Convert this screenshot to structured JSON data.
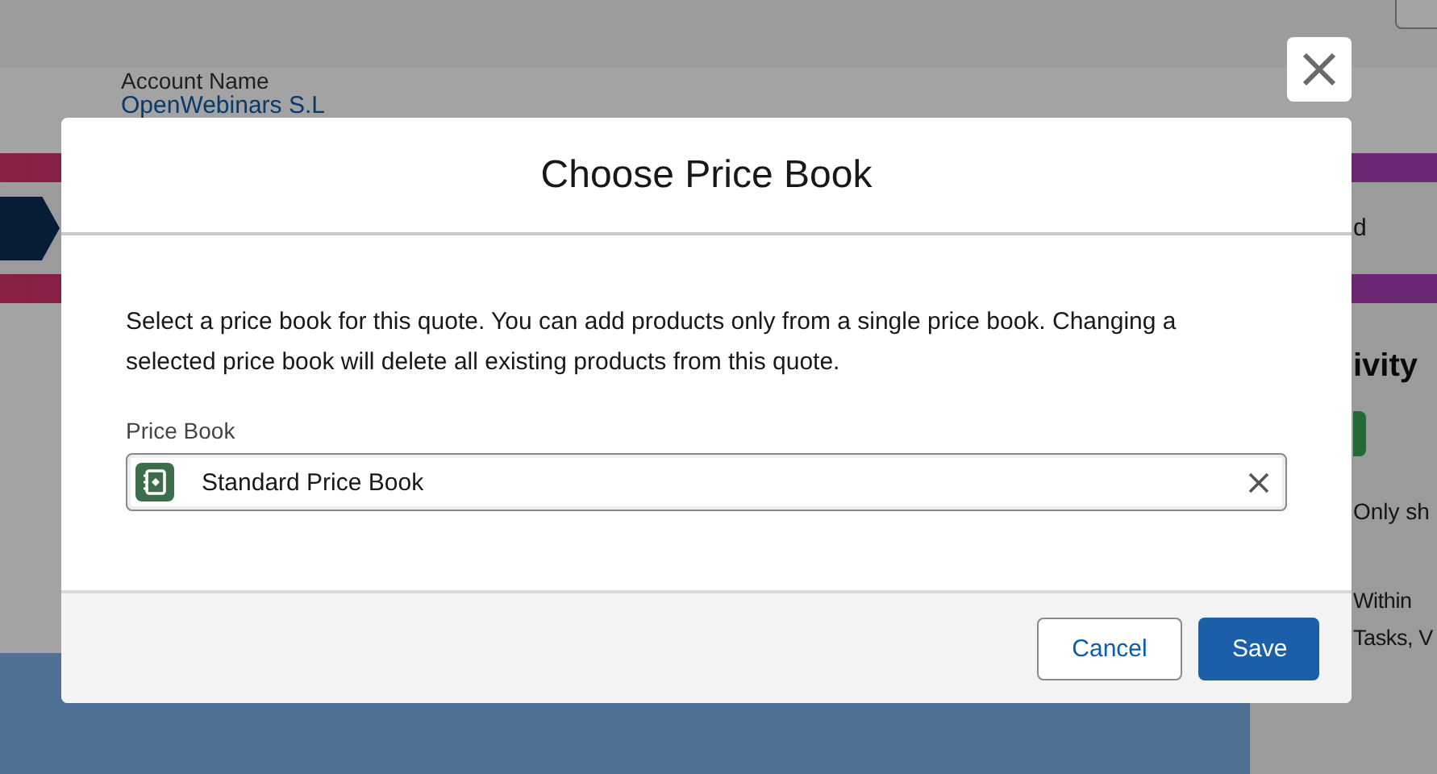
{
  "background": {
    "account_label": "Account Name",
    "account_name": "OpenWebinars S.L",
    "path_stage": "d",
    "activity_tab": "ivity",
    "filter_text": "Only sh",
    "info_lines": [
      "Within",
      "Tasks, V"
    ]
  },
  "modal": {
    "title": "Choose Price Book",
    "description": "Select a price book for this quote. You can add products only from a single price book. Changing a selected price book will delete all existing products from this quote.",
    "field": {
      "label": "Price Book",
      "value": "Standard Price Book"
    },
    "buttons": [
      {
        "label": "Cancel",
        "kind": "neutral"
      },
      {
        "label": "Save",
        "kind": "brand"
      }
    ]
  }
}
